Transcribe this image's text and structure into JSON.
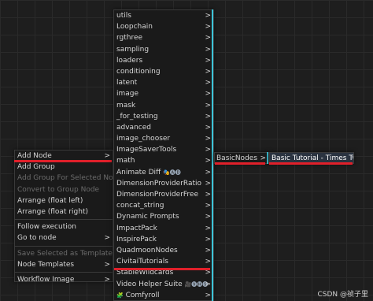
{
  "context_menu": {
    "items": [
      {
        "label": "Add Node",
        "has_submenu": true,
        "disabled": false
      },
      {
        "label": "Add Group",
        "has_submenu": false,
        "disabled": false
      },
      {
        "label": "Add Group For Selected Nodes",
        "has_submenu": false,
        "disabled": true
      },
      {
        "label": "Convert to Group Node",
        "has_submenu": false,
        "disabled": true
      },
      {
        "label": "Arrange (float left)",
        "has_submenu": false,
        "disabled": false
      },
      {
        "label": "Arrange (float right)",
        "has_submenu": false,
        "disabled": false
      },
      {
        "label": "Follow execution",
        "has_submenu": false,
        "disabled": false
      },
      {
        "label": "Go to node",
        "has_submenu": true,
        "disabled": false
      },
      {
        "label": "Save Selected as Template",
        "has_submenu": false,
        "disabled": true
      },
      {
        "label": "Node Templates",
        "has_submenu": true,
        "disabled": false
      },
      {
        "label": "Workflow Image",
        "has_submenu": true,
        "disabled": false
      }
    ]
  },
  "category_menu": {
    "items": [
      {
        "label": "utils"
      },
      {
        "label": "Loopchain"
      },
      {
        "label": "rgthree"
      },
      {
        "label": "sampling"
      },
      {
        "label": "loaders"
      },
      {
        "label": "conditioning"
      },
      {
        "label": "latent"
      },
      {
        "label": "image"
      },
      {
        "label": "mask"
      },
      {
        "label": "_for_testing"
      },
      {
        "label": "advanced"
      },
      {
        "label": "image_chooser"
      },
      {
        "label": "ImageSaverTools"
      },
      {
        "label": "math"
      },
      {
        "label": "Animate Diff",
        "suffix": "🎭🅐🅓"
      },
      {
        "label": "DimensionProviderRatio"
      },
      {
        "label": "DimensionProviderFree"
      },
      {
        "label": "concat_string"
      },
      {
        "label": "Dynamic Prompts"
      },
      {
        "label": "ImpactPack"
      },
      {
        "label": "InspirePack"
      },
      {
        "label": "QuadmoonNodes"
      },
      {
        "label": "CivitaiTutorials"
      },
      {
        "label": "StableWildcards"
      },
      {
        "label": "Video Helper Suite",
        "suffix": "🎥🅥🅗🅢"
      },
      {
        "label": "Comfyroll",
        "prefix": "🧩"
      }
    ],
    "arrow": ">"
  },
  "sub_menu": {
    "label": "BasicNodes",
    "arrow": ">"
  },
  "leaf_menu": {
    "label": "Basic Tutorial - Times Two"
  },
  "watermark": "CSDN @祯子里",
  "colors": {
    "highlight_red": "#e0202a",
    "cyan_edge": "#3cc4d8",
    "menu_bg": "#1a1a1a"
  }
}
